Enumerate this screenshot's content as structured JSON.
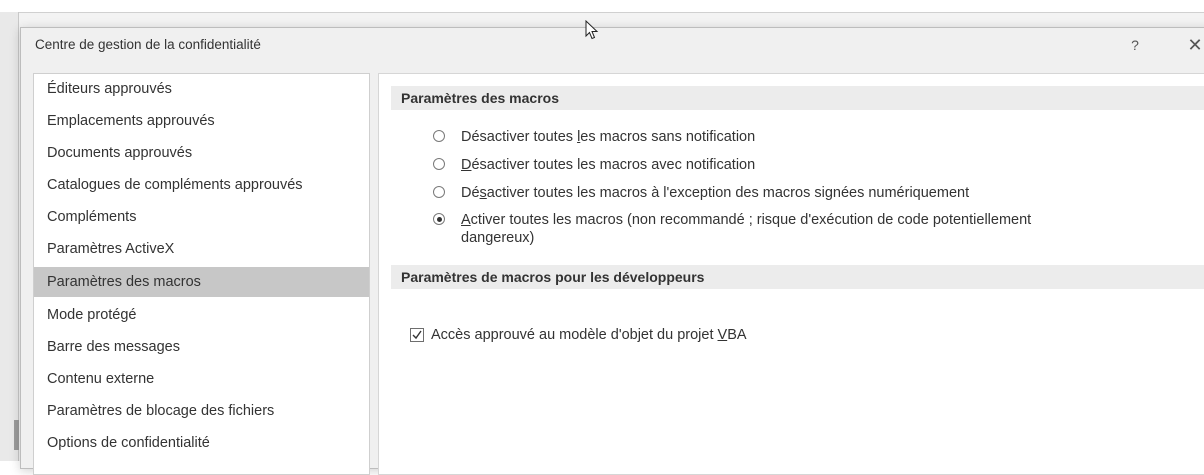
{
  "dialog": {
    "title": "Centre de gestion de la confidentialité",
    "help_label": "?",
    "close_label": "✕"
  },
  "nav": {
    "items": [
      {
        "label": "Éditeurs approuvés",
        "selected": false
      },
      {
        "label": "Emplacements approuvés",
        "selected": false
      },
      {
        "label": "Documents approuvés",
        "selected": false
      },
      {
        "label": "Catalogues de compléments approuvés",
        "selected": false
      },
      {
        "label": "Compléments",
        "selected": false
      },
      {
        "label": "Paramètres ActiveX",
        "selected": false
      },
      {
        "label": "Paramètres des macros",
        "selected": true
      },
      {
        "label": "Mode protégé",
        "selected": false
      },
      {
        "label": "Barre des messages",
        "selected": false
      },
      {
        "label": "Contenu externe",
        "selected": false
      },
      {
        "label": "Paramètres de blocage des fichiers",
        "selected": false
      },
      {
        "label": "Options de confidentialité",
        "selected": false
      }
    ]
  },
  "macros": {
    "header": "Paramètres des macros",
    "options": {
      "opt1": {
        "pre": "Désactiver toutes ",
        "acc": "l",
        "post": "es macros sans notification",
        "checked": false
      },
      "opt2": {
        "pre": "",
        "acc": "D",
        "post": "ésactiver toutes les macros avec notification",
        "checked": false
      },
      "opt3": {
        "pre": "Dé",
        "acc": "s",
        "post": "activer toutes les macros à l'exception des macros signées numériquement",
        "checked": false
      },
      "opt4": {
        "pre": "",
        "acc": "A",
        "post": "ctiver toutes les macros (non recommandé ; risque d'exécution de code potentiellement",
        "line2": "dangereux)",
        "checked": true
      }
    }
  },
  "developers": {
    "header": "Paramètres de macros pour les développeurs",
    "vba_access": {
      "pre": "Accès approuvé au modèle d'objet du projet ",
      "acc": "V",
      "post": "BA",
      "checked": true
    }
  },
  "icons": {
    "cursor": "mouse-pointer-icon",
    "check": "checkmark-icon"
  }
}
